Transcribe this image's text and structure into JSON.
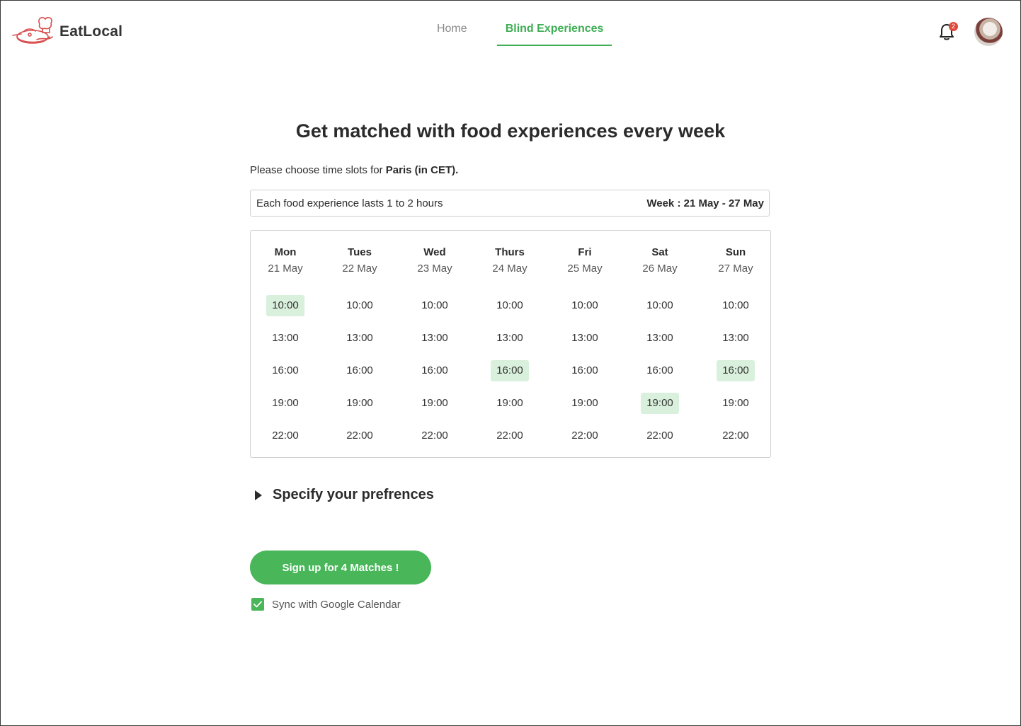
{
  "app": {
    "name": "EatLocal"
  },
  "nav": {
    "items": [
      {
        "label": "Home"
      },
      {
        "label": "Blind Experiences"
      }
    ]
  },
  "header": {
    "notification_count": "2"
  },
  "main": {
    "title": "Get matched with food experiences every week",
    "subtitle_prefix": "Please choose time slots for ",
    "subtitle_location": "Paris (in CET).",
    "info_text": "Each food experience lasts 1 to 2 hours",
    "week_label": "Week : 21 May - 27 May"
  },
  "calendar": {
    "days": [
      {
        "name": "Mon",
        "date": "21 May",
        "slots": [
          {
            "time": "10:00",
            "selected": true
          },
          {
            "time": "13:00",
            "selected": false
          },
          {
            "time": "16:00",
            "selected": false
          },
          {
            "time": "19:00",
            "selected": false
          },
          {
            "time": "22:00",
            "selected": false
          }
        ]
      },
      {
        "name": "Tues",
        "date": "22 May",
        "slots": [
          {
            "time": "10:00",
            "selected": false
          },
          {
            "time": "13:00",
            "selected": false
          },
          {
            "time": "16:00",
            "selected": false
          },
          {
            "time": "19:00",
            "selected": false
          },
          {
            "time": "22:00",
            "selected": false
          }
        ]
      },
      {
        "name": "Wed",
        "date": "23 May",
        "slots": [
          {
            "time": "10:00",
            "selected": false
          },
          {
            "time": "13:00",
            "selected": false
          },
          {
            "time": "16:00",
            "selected": false
          },
          {
            "time": "19:00",
            "selected": false
          },
          {
            "time": "22:00",
            "selected": false
          }
        ]
      },
      {
        "name": "Thurs",
        "date": "24 May",
        "slots": [
          {
            "time": "10:00",
            "selected": false
          },
          {
            "time": "13:00",
            "selected": false
          },
          {
            "time": "16:00",
            "selected": true
          },
          {
            "time": "19:00",
            "selected": false
          },
          {
            "time": "22:00",
            "selected": false
          }
        ]
      },
      {
        "name": "Fri",
        "date": "25 May",
        "slots": [
          {
            "time": "10:00",
            "selected": false
          },
          {
            "time": "13:00",
            "selected": false
          },
          {
            "time": "16:00",
            "selected": false
          },
          {
            "time": "19:00",
            "selected": false
          },
          {
            "time": "22:00",
            "selected": false
          }
        ]
      },
      {
        "name": "Sat",
        "date": "26 May",
        "slots": [
          {
            "time": "10:00",
            "selected": false
          },
          {
            "time": "13:00",
            "selected": false
          },
          {
            "time": "16:00",
            "selected": false
          },
          {
            "time": "19:00",
            "selected": true
          },
          {
            "time": "22:00",
            "selected": false
          }
        ]
      },
      {
        "name": "Sun",
        "date": "27 May",
        "slots": [
          {
            "time": "10:00",
            "selected": false
          },
          {
            "time": "13:00",
            "selected": false
          },
          {
            "time": "16:00",
            "selected": true
          },
          {
            "time": "19:00",
            "selected": false
          },
          {
            "time": "22:00",
            "selected": false
          }
        ]
      }
    ]
  },
  "preferences": {
    "label": "Specify your prefrences"
  },
  "actions": {
    "signup_label": "Sign up for 4 Matches !",
    "sync_label": "Sync with Google Calendar",
    "sync_checked": true
  },
  "colors": {
    "accent": "#48b659",
    "selected_slot": "#d9f0dc",
    "badge": "#e04a3c",
    "logo": "#d94c4c"
  }
}
